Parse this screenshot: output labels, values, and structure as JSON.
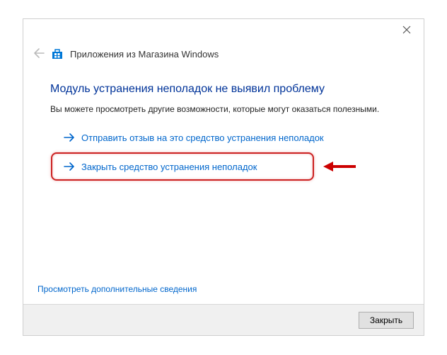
{
  "window": {
    "title": "Приложения из Магазина Windows"
  },
  "content": {
    "heading": "Модуль устранения неполадок не выявил проблему",
    "subtext": "Вы можете просмотреть другие возможности, которые могут оказаться полезными.",
    "link_feedback": "Отправить отзыв на это средство устранения неполадок",
    "link_close_tool": "Закрыть средство устранения неполадок",
    "more_info": "Просмотреть дополнительные сведения"
  },
  "footer": {
    "close_label": "Закрыть"
  }
}
